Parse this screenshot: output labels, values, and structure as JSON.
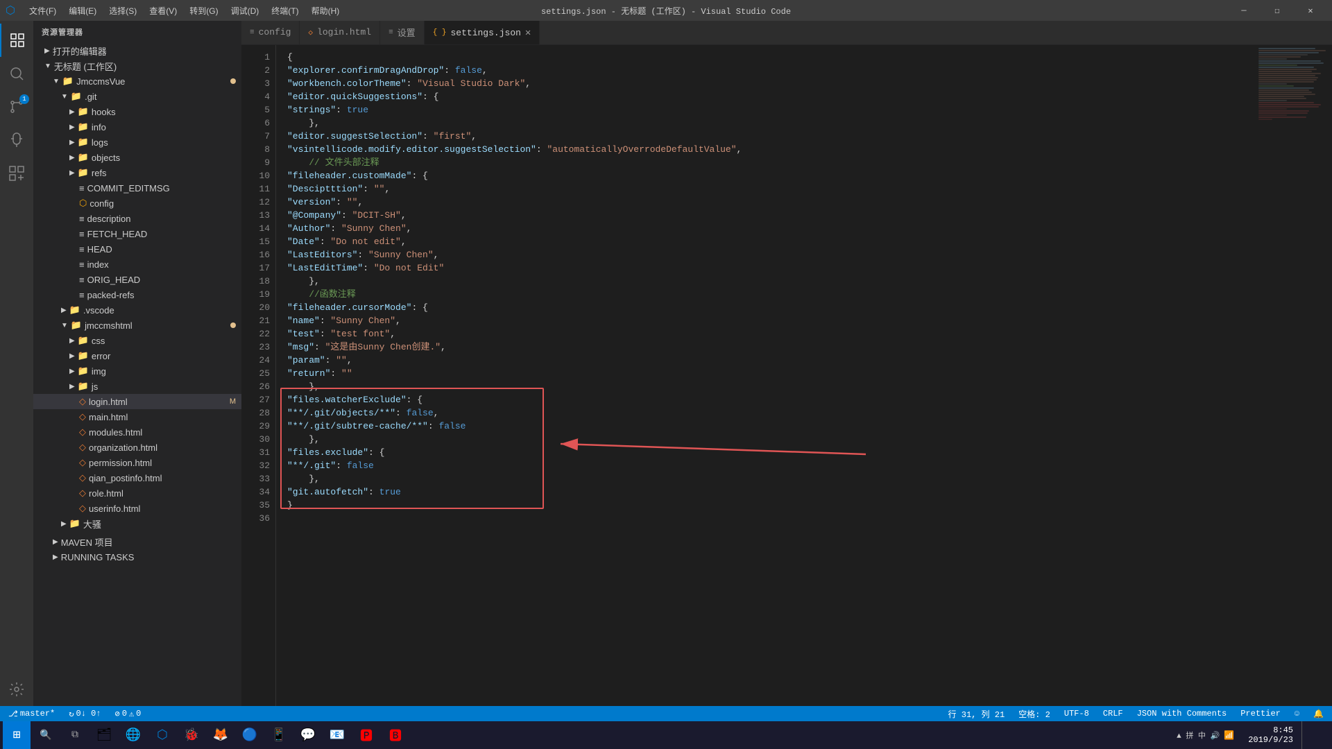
{
  "titleBar": {
    "title": "settings.json - 无标题 (工作区) - Visual Studio Code",
    "menus": [
      "文件(F)",
      "编辑(E)",
      "选择(S)",
      "查看(V)",
      "转到(G)",
      "调试(D)",
      "终端(T)",
      "帮助(H)"
    ],
    "controls": [
      "—",
      "☐",
      "✕"
    ]
  },
  "sidebar": {
    "header": "资源管理器",
    "openEditors": "打开的编辑器",
    "workspace": "无标题 (工作区)",
    "project": "JmccmsVue",
    "gitFolder": ".git",
    "hooks": "hooks",
    "info": "info",
    "logs": "logs",
    "objects": "objects",
    "refs": "refs",
    "commitMsg": "COMMIT_EDITMSG",
    "config": "config",
    "description": "description",
    "fetchHead": "FETCH_HEAD",
    "head": "HEAD",
    "index": "index",
    "origHead": "ORIG_HEAD",
    "packedRefs": "packed-refs",
    "vscode": ".vscode",
    "jmccmshtml": "jmccmshtml",
    "css": "css",
    "error": "error",
    "img": "img",
    "js": "js",
    "loginHtml": "login.html",
    "mainHtml": "main.html",
    "modulesHtml": "modules.html",
    "organizationHtml": "organization.html",
    "permissionHtml": "permission.html",
    "qianPostinfoHtml": "qian_postinfo.html",
    "roleHtml": "role.html",
    "userinfoHtml": "userinfo.html",
    "daSao": "大骚",
    "mavenProject": "MAVEN 项目",
    "runningTasks": "RUNNING TASKS"
  },
  "tabs": [
    {
      "id": "config",
      "label": "config",
      "icon": "≡",
      "active": false,
      "modified": false
    },
    {
      "id": "login",
      "label": "login.html",
      "icon": "◇",
      "active": false,
      "modified": false
    },
    {
      "id": "settings2",
      "label": "设置",
      "icon": "≡",
      "active": false,
      "modified": false
    },
    {
      "id": "settings",
      "label": "settings.json",
      "icon": "{ }",
      "active": true,
      "modified": false
    }
  ],
  "code": {
    "lines": [
      {
        "num": 1,
        "content": "{"
      },
      {
        "num": 2,
        "content": "    \"explorer.confirmDragAndDrop\": false,"
      },
      {
        "num": 3,
        "content": "    \"workbench.colorTheme\": \"Visual Studio Dark\","
      },
      {
        "num": 4,
        "content": "    \"editor.quickSuggestions\": {"
      },
      {
        "num": 5,
        "content": "        \"strings\": true"
      },
      {
        "num": 6,
        "content": "    },"
      },
      {
        "num": 7,
        "content": "    \"editor.suggestSelection\": \"first\","
      },
      {
        "num": 8,
        "content": "    \"vsintellicode.modify.editor.suggestSelection\": \"automaticallyOverrodeDefaultValue\","
      },
      {
        "num": 9,
        "content": "    // 文件头部注释"
      },
      {
        "num": 10,
        "content": "    \"fileheader.customMade\": {"
      },
      {
        "num": 11,
        "content": "        \"Desciptttion\": \"\","
      },
      {
        "num": 12,
        "content": "        \"version\": \"\","
      },
      {
        "num": 13,
        "content": "        \"@Company\": \"DCIT-SH\","
      },
      {
        "num": 14,
        "content": "        \"Author\": \"Sunny Chen\","
      },
      {
        "num": 15,
        "content": "        \"Date\": \"Do not edit\","
      },
      {
        "num": 16,
        "content": "        \"LastEditors\": \"Sunny Chen\","
      },
      {
        "num": 17,
        "content": "        \"LastEditTime\": \"Do not Edit\""
      },
      {
        "num": 18,
        "content": "    },"
      },
      {
        "num": 19,
        "content": "    //函数注释"
      },
      {
        "num": 20,
        "content": "    \"fileheader.cursorMode\": {"
      },
      {
        "num": 21,
        "content": "        \"name\": \"Sunny Chen\","
      },
      {
        "num": 22,
        "content": "        \"test\": \"test font\","
      },
      {
        "num": 23,
        "content": "        \"msg\": \"这是由Sunny Chen创建.\","
      },
      {
        "num": 24,
        "content": "        \"param\": \"\","
      },
      {
        "num": 25,
        "content": "        \"return\": \"\""
      },
      {
        "num": 26,
        "content": "    },"
      },
      {
        "num": 27,
        "content": "    \"files.watcherExclude\": {"
      },
      {
        "num": 28,
        "content": "        \"**/.git/objects/**\": false,"
      },
      {
        "num": 29,
        "content": "        \"**/.git/subtree-cache/**\": false"
      },
      {
        "num": 30,
        "content": "    },"
      },
      {
        "num": 31,
        "content": "    \"files.exclude\": {"
      },
      {
        "num": 32,
        "content": "        \"**/.git\": false"
      },
      {
        "num": 33,
        "content": "    },"
      },
      {
        "num": 34,
        "content": "    \"git.autofetch\": true"
      },
      {
        "num": 35,
        "content": "}"
      },
      {
        "num": 36,
        "content": ""
      }
    ]
  },
  "statusBar": {
    "branch": "master*",
    "sync": "↻",
    "errors": "⊘ 0",
    "warnings": "⚠ 0",
    "row": "行 31, 列 21",
    "spaces": "空格: 2",
    "encoding": "UTF-8",
    "lineEnding": "CRLF",
    "language": "JSON with Comments",
    "formatter": "Prettier",
    "emoji": "☺",
    "bell": "🔔"
  },
  "taskbar": {
    "time": "8:45",
    "date": "2019/9/23",
    "sysTray": "⊕ 🔊 拼 中 ▲"
  }
}
